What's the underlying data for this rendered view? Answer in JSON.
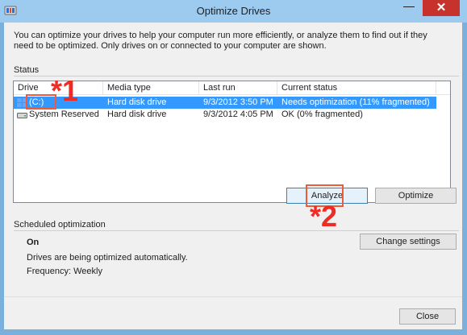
{
  "window": {
    "title": "Optimize Drives",
    "minimize_glyph": "—",
    "close_glyph": "✕",
    "app_icon": "defrag-icon"
  },
  "intro_text": "You can optimize your drives to help your computer run more efficiently, or analyze them to find out if they need to be optimized. Only drives on or connected to your computer are shown.",
  "status": {
    "section_label": "Status",
    "columns": [
      "Drive",
      "Media type",
      "Last run",
      "Current status"
    ],
    "rows": [
      {
        "drive": "(C:)",
        "media_type": "Hard disk drive",
        "last_run": "9/3/2012 3:50 PM",
        "current_status": "Needs optimization (11% fragmented)",
        "selected": true,
        "icon": "windows-drive-icon"
      },
      {
        "drive": "System Reserved",
        "media_type": "Hard disk drive",
        "last_run": "9/3/2012 4:05 PM",
        "current_status": "OK (0% fragmented)",
        "selected": false,
        "icon": "drive-icon"
      }
    ],
    "analyze_label": "Analyze",
    "optimize_label": "Optimize"
  },
  "schedule": {
    "section_label": "Scheduled optimization",
    "state": "On",
    "description": "Drives are being optimized automatically.",
    "frequency": "Frequency: Weekly",
    "change_settings_label": "Change settings"
  },
  "footer": {
    "close_label": "Close"
  },
  "annotations": {
    "marker1": "*1",
    "marker2": "*2",
    "color": "#ee2b24"
  },
  "colors": {
    "title_bar": "#9dcaef",
    "selection": "#3399ff",
    "close_button": "#c7322d"
  }
}
